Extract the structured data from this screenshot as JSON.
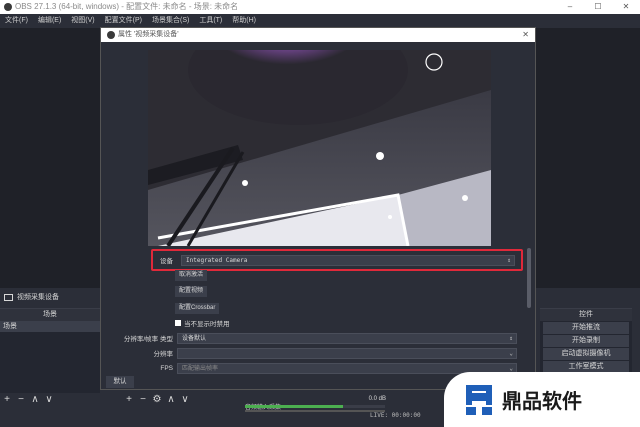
{
  "window": {
    "title": "OBS 27.1.3 (64-bit, windows) - 配置文件: 未命名 - 场景: 未命名",
    "controls": [
      "–",
      "☐",
      "✕"
    ]
  },
  "menubar": [
    "文件(F)",
    "编辑(E)",
    "视图(V)",
    "配置文件(P)",
    "场景集合(S)",
    "工具(T)",
    "帮助(H)"
  ],
  "source_title": "视频采集设备",
  "scenes": {
    "header": "场景",
    "items": [
      "场景"
    ]
  },
  "controls": {
    "header": "控件",
    "buttons": [
      "开始推流",
      "开始录制",
      "启动虚拟摄像机",
      "工作室模式"
    ]
  },
  "toolbar": {
    "left": [
      "+",
      "−",
      "∧",
      "∨"
    ],
    "middle": [
      "+",
      "−",
      "⚙",
      "∧",
      "∨"
    ]
  },
  "audio": {
    "label": "音频输入采集",
    "db": "0.0 dB"
  },
  "status": "LIVE: 00:00:00",
  "dialog": {
    "title": "属性 '视频采集设备'",
    "close": "✕",
    "device_label": "设备",
    "device_value": "Integrated Camera",
    "btn_deactivate": "取消激活",
    "btn_config_video": "配置视频",
    "btn_crossbar": "配置Crossbar",
    "checkbox_label": "当不显示时禁用",
    "resolution_label": "分辨率/帧率 类型",
    "resolution_value": "设备默认",
    "res_label": "分辨率",
    "res_value": "",
    "fps_label": "FPS",
    "fps_value": "匹配输出帧率",
    "defaults_btn": "默认"
  },
  "watermark": {
    "text": "鼎品软件"
  }
}
